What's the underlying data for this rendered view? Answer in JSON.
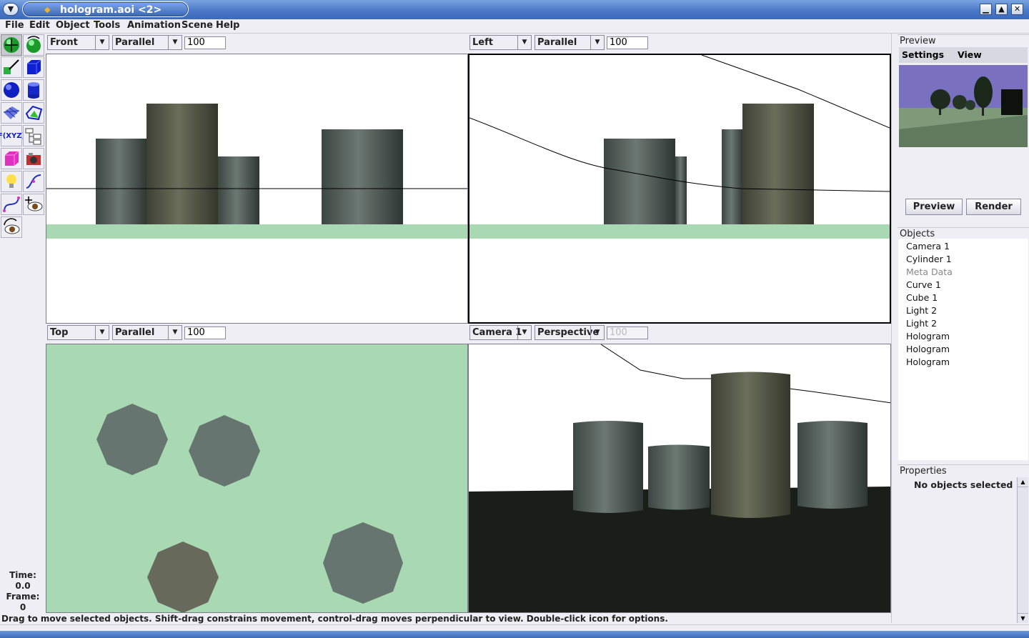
{
  "window": {
    "title": "hologram.aoi <2>",
    "controls": [
      "minimize",
      "maximize",
      "close"
    ]
  },
  "menubar": [
    "File",
    "Edit",
    "Object",
    "Tools",
    "Animation",
    "Scene",
    "Help"
  ],
  "toolbox": [
    {
      "icon": "move-tool-icon",
      "selected": true
    },
    {
      "icon": "rotate-tool-icon"
    },
    {
      "icon": "scale-tool-icon"
    },
    {
      "icon": "cube-tool-icon"
    },
    {
      "icon": "sphere-tool-icon"
    },
    {
      "icon": "cylinder-tool-icon"
    },
    {
      "icon": "polymesh-tool-icon"
    },
    {
      "icon": "spline-mesh-tool-icon"
    },
    {
      "icon": "fxyz-tool-icon",
      "label": "F(XYZ)"
    },
    {
      "icon": "hierarchy-tool-icon"
    },
    {
      "icon": "reference-object-icon"
    },
    {
      "icon": "camera-tool-icon"
    },
    {
      "icon": "light-tool-icon"
    },
    {
      "icon": "curve-tool-icon"
    },
    {
      "icon": "bezier-tool-icon"
    },
    {
      "icon": "move-view-icon"
    },
    {
      "icon": "rotate-view-icon"
    }
  ],
  "viewports": [
    {
      "view": "Front",
      "projection": "Parallel",
      "scale": "100"
    },
    {
      "view": "Left",
      "projection": "Parallel",
      "scale": "100"
    },
    {
      "view": "Top",
      "projection": "Parallel",
      "scale": "100"
    },
    {
      "view": "Camera 1",
      "projection": "Perspective",
      "scale": "100"
    }
  ],
  "timeline": {
    "time_label": "Time:",
    "time": "0.0",
    "frame_label": "Frame:",
    "frame": "0"
  },
  "status": "Drag to move selected objects.  Shift-drag constrains movement, control-drag moves perpendicular to view.  Double-click icon for options.",
  "preview": {
    "title": "Preview",
    "menu": [
      "Settings",
      "View"
    ],
    "buttons": {
      "preview": "Preview",
      "render": "Render"
    }
  },
  "objects": {
    "title": "Objects",
    "items": [
      "Camera 1",
      "Cylinder 1",
      "Meta Data",
      "Curve 1",
      "Cube 1",
      "Light 2",
      "Light 2",
      "Hologram",
      "Hologram",
      "Hologram"
    ]
  },
  "properties": {
    "title": "Properties",
    "empty_text": "No objects selected"
  },
  "colors": {
    "ground": "#a9d9b2",
    "cyl_gray": "#5e6963",
    "cyl_olive": "#5f6251",
    "title_blue": "#4a78c8",
    "sky": "#7a70c0"
  }
}
